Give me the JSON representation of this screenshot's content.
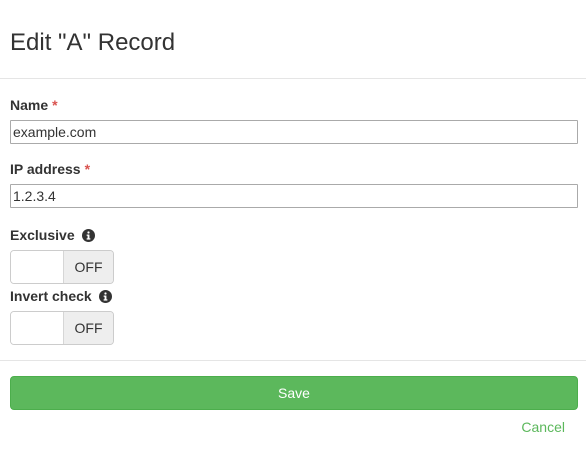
{
  "dialog": {
    "title": "Edit \"A\" Record"
  },
  "form": {
    "name": {
      "label": "Name",
      "required_mark": "*",
      "value": "example.com"
    },
    "ip_address": {
      "label": "IP address",
      "required_mark": "*",
      "value": "1.2.3.4"
    },
    "exclusive": {
      "label": "Exclusive",
      "state": "OFF",
      "info_icon": "info-circle-icon"
    },
    "invert_check": {
      "label": "Invert check",
      "state": "OFF",
      "info_icon": "info-circle-icon"
    }
  },
  "actions": {
    "save_label": "Save",
    "cancel_label": "Cancel"
  },
  "colors": {
    "primary_green": "#5cb85c",
    "required_red": "#d9534f"
  }
}
